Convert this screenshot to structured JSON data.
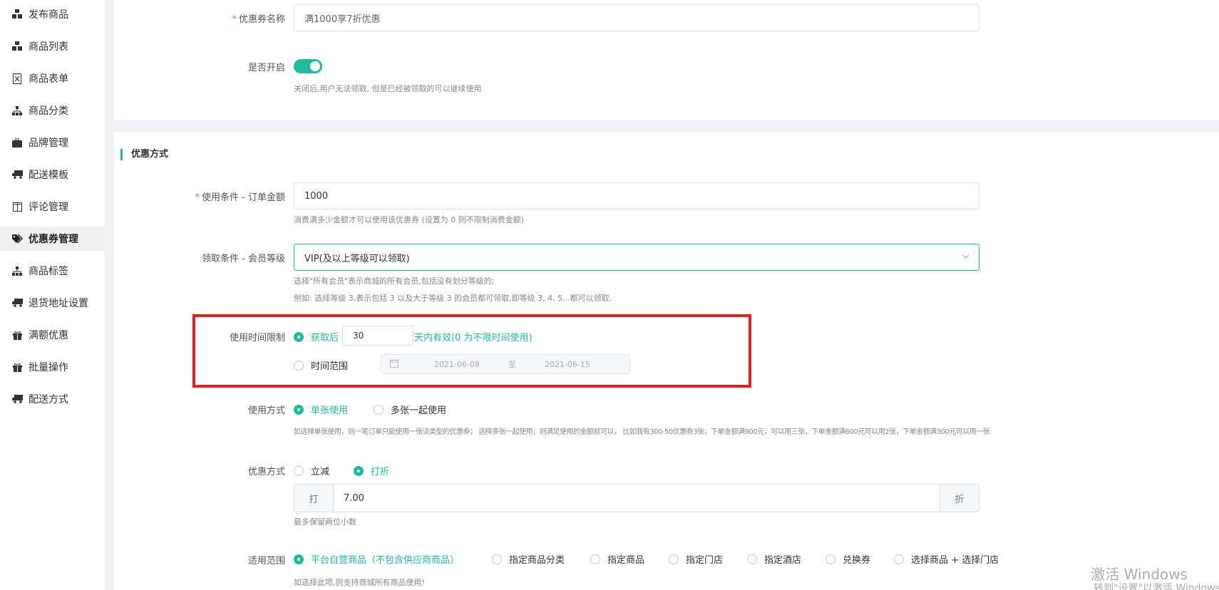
{
  "sidebar": {
    "items": [
      {
        "label": "发布商品",
        "icon": "cubes-icon"
      },
      {
        "label": "商品列表",
        "icon": "cubes-icon"
      },
      {
        "label": "商品表单",
        "icon": "excel-file-icon"
      },
      {
        "label": "商品分类",
        "icon": "sitemap-icon"
      },
      {
        "label": "品牌管理",
        "icon": "briefcase-icon"
      },
      {
        "label": "配送模板",
        "icon": "truck-icon"
      },
      {
        "label": "评论管理",
        "icon": "columns-icon"
      },
      {
        "label": "优惠券管理",
        "icon": "tags-icon"
      },
      {
        "label": "商品标签",
        "icon": "sitemap-icon"
      },
      {
        "label": "退货地址设置",
        "icon": "truck-icon"
      },
      {
        "label": "满额优惠",
        "icon": "gift-icon"
      },
      {
        "label": "批量操作",
        "icon": "gift-icon"
      },
      {
        "label": "配送方式",
        "icon": "truck-icon"
      }
    ],
    "active_index": 7
  },
  "basic": {
    "name_label": "优惠券名称",
    "name_value": "满1000享7折优惠",
    "enable_label": "是否开启",
    "enable_on": true,
    "enable_help": "关闭后,用户无法领取, 但是已经被领取的可以继续使用"
  },
  "discount_section": {
    "title": "优惠方式",
    "condition_label": "使用条件 - 订单金额",
    "condition_value": "1000",
    "condition_help": "消费满多少金额才可以使用该优惠券 (设置为 0 则不限制消费金额)",
    "member_label": "领取条件 - 会员等级",
    "member_value": "VIP(及以上等级可以领取)",
    "member_help1": "选择\"所有会员\"表示商城的所有会员,包括没有划分等级的;",
    "member_help2": "例如: 选择等级 3,表示包括 3 以及大于等级 3 的会员都可领取,即等级 3, 4, 5...都可以领取.",
    "time_label": "使用时间限制",
    "time_option1_prefix": "获取后",
    "time_days": "30",
    "time_option1_suffix": "天内有效(0 为不限时间使用)",
    "time_option2": "时间范围",
    "date_start": "2021-06-08",
    "date_sep": "至",
    "date_end": "2021-06-15",
    "usage_label": "使用方式",
    "usage_opt1": "单张使用",
    "usage_opt2": "多张一起使用",
    "usage_help": "如选择单张使用，则一笔订单只能使用一张该类型的优惠券； 选择多张一起使用，则满足使用的金额就可以， 比如我有300-50优惠券3张，下单金额满900元，可以用三张，下单金额满600元可以用2张，下单金额满300元可以用一张",
    "mode_label": "优惠方式",
    "mode_opt1": "立减",
    "mode_opt2": "打折",
    "discount_prefix": "打",
    "discount_value": "7.00",
    "discount_suffix": "折",
    "discount_help": "最多保留两位小数",
    "scope_label": "适用范围",
    "scope_options": [
      "平台自营商品（不包含供应商商品）",
      "指定商品分类",
      "指定商品",
      "指定门店",
      "指定酒店",
      "兑换券",
      "选择商品 + 选择门店"
    ],
    "scope_help": "如选择此项,则支持商城所有商品使用!"
  },
  "watermark": {
    "line1": "激活 Windows",
    "line2": "转到\"设置\"以激活 Windows。"
  },
  "colors": {
    "accent": "#1fbc9c",
    "highlight": "#e5201c"
  }
}
